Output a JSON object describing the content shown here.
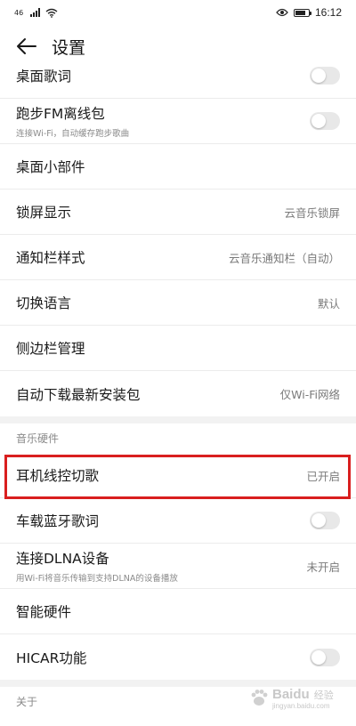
{
  "status_bar": {
    "signal_label": "46",
    "time": "16:12",
    "battery_level": 0.8
  },
  "app_bar": {
    "title": "设置"
  },
  "section_music_hardware": "音乐硬件",
  "section_about": "关于",
  "rows_top": [
    {
      "label": "桌面歌词",
      "toggle": false
    },
    {
      "label": "跑步FM离线包",
      "sub": "连接Wi-Fi，自动缓存跑步歌曲",
      "toggle": false
    },
    {
      "label": "桌面小部件"
    },
    {
      "label": "锁屏显示",
      "value": "云音乐锁屏"
    },
    {
      "label": "通知栏样式",
      "value": "云音乐通知栏（自动）"
    },
    {
      "label": "切换语言",
      "value": "默认"
    },
    {
      "label": "侧边栏管理"
    },
    {
      "label": "自动下载最新安装包",
      "value": "仅Wi-Fi网络"
    }
  ],
  "rows_hw": [
    {
      "label": "耳机线控切歌",
      "value": "已开启"
    },
    {
      "label": "车载蓝牙歌词",
      "toggle": false
    },
    {
      "label": "连接DLNA设备",
      "sub": "用Wi-Fi将音乐传输到支持DLNA的设备播放",
      "value": "未开启"
    },
    {
      "label": "智能硬件"
    },
    {
      "label": "HICAR功能",
      "toggle": false
    }
  ],
  "watermark": {
    "brand": "Baidu",
    "cn": "经验",
    "url": "jingyan.baidu.com"
  },
  "colors": {
    "highlight": "#d91f1f",
    "toggle_off": "#e8e8e8",
    "divider": "#ececec"
  }
}
